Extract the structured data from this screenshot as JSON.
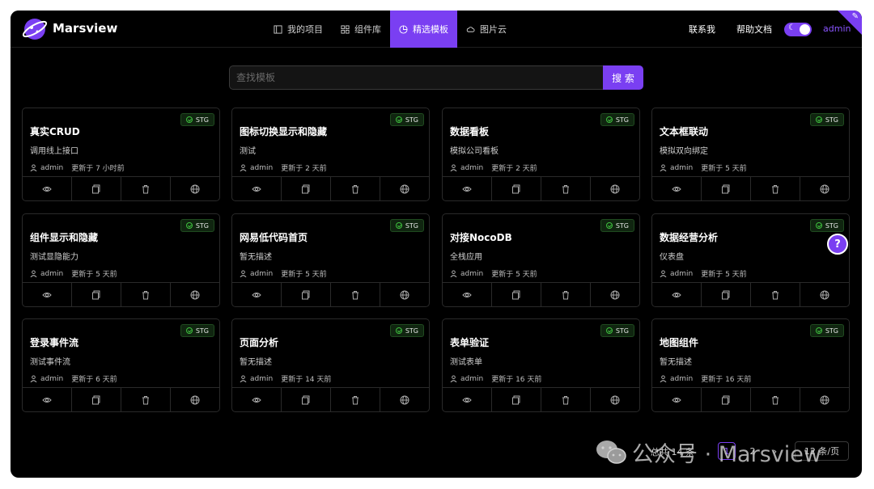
{
  "header": {
    "app_name": "Marsview",
    "nav": [
      {
        "label": "我的项目",
        "icon": "project-icon",
        "active": false
      },
      {
        "label": "组件库",
        "icon": "grid-icon",
        "active": false
      },
      {
        "label": "精选模板",
        "icon": "chart-pie-icon",
        "active": true
      },
      {
        "label": "图片云",
        "icon": "cloud-icon",
        "active": false
      }
    ],
    "contact": "联系我",
    "help": "帮助文档",
    "theme_toggle": "dark",
    "user": "admin"
  },
  "search": {
    "placeholder": "查找模板",
    "button": "搜 索"
  },
  "cards": [
    {
      "title": "真实CRUD",
      "desc": "调用线上接口",
      "user": "admin",
      "updated": "更新于 7 小时前",
      "tag": "STG"
    },
    {
      "title": "图标切换显示和隐藏",
      "desc": "测试",
      "user": "admin",
      "updated": "更新于 2 天前",
      "tag": "STG"
    },
    {
      "title": "数据看板",
      "desc": "模拟公司看板",
      "user": "admin",
      "updated": "更新于 2 天前",
      "tag": "STG"
    },
    {
      "title": "文本框联动",
      "desc": "模拟双向绑定",
      "user": "admin",
      "updated": "更新于 5 天前",
      "tag": "STG"
    },
    {
      "title": "组件显示和隐藏",
      "desc": "测试显隐能力",
      "user": "admin",
      "updated": "更新于 5 天前",
      "tag": "STG"
    },
    {
      "title": "网易低代码首页",
      "desc": "暂无描述",
      "user": "admin",
      "updated": "更新于 5 天前",
      "tag": "STG"
    },
    {
      "title": "对接NocoDB",
      "desc": "全栈应用",
      "user": "admin",
      "updated": "更新于 5 天前",
      "tag": "STG"
    },
    {
      "title": "数据经营分析",
      "desc": "仪表盘",
      "user": "admin",
      "updated": "更新于 5 天前",
      "tag": "STG"
    },
    {
      "title": "登录事件流",
      "desc": "测试事件流",
      "user": "admin",
      "updated": "更新于 6 天前",
      "tag": "STG"
    },
    {
      "title": "页面分析",
      "desc": "暂无描述",
      "user": "admin",
      "updated": "更新于 14 天前",
      "tag": "STG"
    },
    {
      "title": "表单验证",
      "desc": "测试表单",
      "user": "admin",
      "updated": "更新于 16 天前",
      "tag": "STG"
    },
    {
      "title": "地图组件",
      "desc": "暂无描述",
      "user": "admin",
      "updated": "更新于 16 天前",
      "tag": "STG"
    }
  ],
  "card_actions": [
    "eye-icon",
    "copy-icon",
    "trash-icon",
    "globe-icon"
  ],
  "pagination": {
    "total": "总共 14 条",
    "pages": [
      "1",
      "2"
    ],
    "current": "1",
    "next": "›",
    "page_size": "12 条/页"
  },
  "watermark": {
    "text": "公众号 · Marsview"
  },
  "colors": {
    "accent": "#7a3ff2",
    "background": "#000000",
    "tag_green": "#3fc23f"
  }
}
